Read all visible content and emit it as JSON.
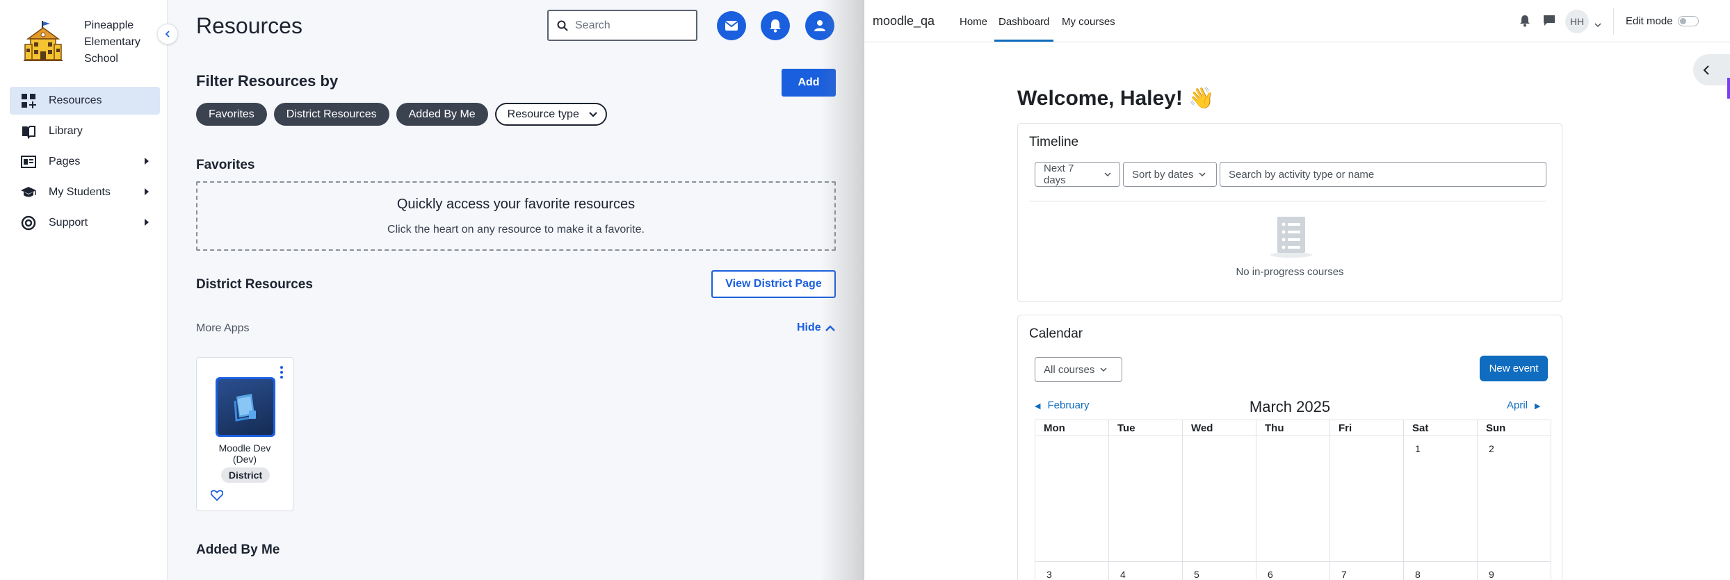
{
  "left": {
    "school_name": [
      "Pineapple",
      "Elementary",
      "School"
    ],
    "nav": [
      {
        "label": "Resources",
        "icon": "resources-icon",
        "active": true,
        "caret": false
      },
      {
        "label": "Library",
        "icon": "library-icon",
        "active": false,
        "caret": false
      },
      {
        "label": "Pages",
        "icon": "pages-icon",
        "active": false,
        "caret": true
      },
      {
        "label": "My Students",
        "icon": "graduation-cap-icon",
        "active": false,
        "caret": true
      },
      {
        "label": "Support",
        "icon": "lifebuoy-icon",
        "active": false,
        "caret": true
      }
    ],
    "page_title": "Resources",
    "search_placeholder": "Search",
    "filter_title": "Filter Resources by",
    "add_label": "Add",
    "chips": [
      "Favorites",
      "District Resources",
      "Added By Me"
    ],
    "resource_type_label": "Resource type",
    "favorites_title": "Favorites",
    "favorites_empty_title": "Quickly access your favorite resources",
    "favorites_empty_text": "Click the heart on any resource to make it a favorite.",
    "district_title": "District Resources",
    "view_district_label": "View District Page",
    "more_apps_label": "More Apps",
    "hide_label": "Hide",
    "app_card": {
      "name_line1": "Moodle Dev",
      "name_line2": "(Dev)",
      "badge": "District"
    },
    "added_by_me_title": "Added By Me",
    "accent_color": "#1a5fde"
  },
  "right": {
    "brand": "moodle_qa",
    "nav_links": [
      "Home",
      "Dashboard",
      "My courses"
    ],
    "active_link": "Dashboard",
    "avatar_initials": "HH",
    "edit_mode_label": "Edit mode",
    "welcome": "Welcome, Haley! 👋",
    "timeline": {
      "title": "Timeline",
      "range_select": "Next 7 days",
      "sort_select": "Sort by dates",
      "search_placeholder": "Search by activity type or name",
      "empty_text": "No in-progress courses"
    },
    "calendar": {
      "title": "Calendar",
      "course_select": "All courses",
      "new_event_label": "New event",
      "prev_month": "February",
      "next_month": "April",
      "month_title": "March 2025",
      "weekdays": [
        "Mon",
        "Tue",
        "Wed",
        "Thu",
        "Fri",
        "Sat",
        "Sun"
      ],
      "week1": [
        "",
        "",
        "",
        "",
        "",
        "1",
        "2"
      ],
      "week2": [
        "3",
        "4",
        "5",
        "6",
        "7",
        "8",
        "9"
      ]
    },
    "accent_color": "#0f6cbf"
  }
}
